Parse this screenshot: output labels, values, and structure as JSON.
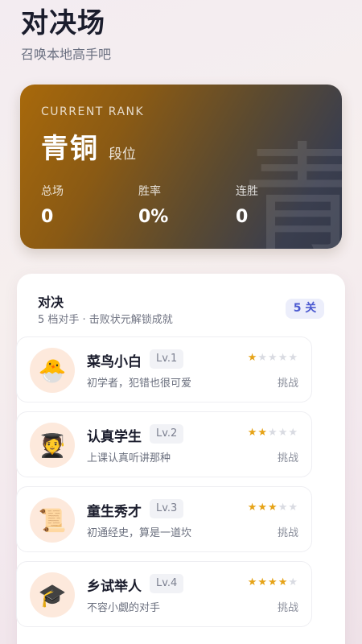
{
  "header": {
    "title": "对决场",
    "subtitle": "召唤本地高手吧"
  },
  "rank": {
    "label": "CURRENT RANK",
    "name": "青铜",
    "suffix": "段位",
    "watermark": "青",
    "stats": [
      {
        "key": "总场",
        "value": "0"
      },
      {
        "key": "胜率",
        "value": "0%"
      },
      {
        "key": "连胜",
        "value": "0"
      }
    ]
  },
  "panel": {
    "title": "对决",
    "subtitle": "5 档对手 · 击败状元解锁成就",
    "badge": "5 关"
  },
  "opponents": [
    {
      "name": "菜鸟小白",
      "level": "Lv.1",
      "desc": "初学者，犯错也很可爱",
      "stars": 1,
      "action": "挑战",
      "icon": "hatching-chick-icon",
      "glyph": "🐣"
    },
    {
      "name": "认真学生",
      "level": "Lv.2",
      "desc": "上课认真听讲那种",
      "stars": 2,
      "action": "挑战",
      "icon": "student-icon",
      "glyph": "🧑‍🎓"
    },
    {
      "name": "童生秀才",
      "level": "Lv.3",
      "desc": "初通经史，算是一道坎",
      "stars": 3,
      "action": "挑战",
      "icon": "scroll-icon",
      "glyph": "📜"
    },
    {
      "name": "乡试举人",
      "level": "Lv.4",
      "desc": "不容小觑的对手",
      "stars": 4,
      "action": "挑战",
      "icon": "graduation-cap-icon",
      "glyph": "🎓"
    }
  ],
  "colors": {
    "accent": "#4d5bd1",
    "star": "#e6a317",
    "rank_start": "#a8690b",
    "rank_end": "#34394a"
  }
}
